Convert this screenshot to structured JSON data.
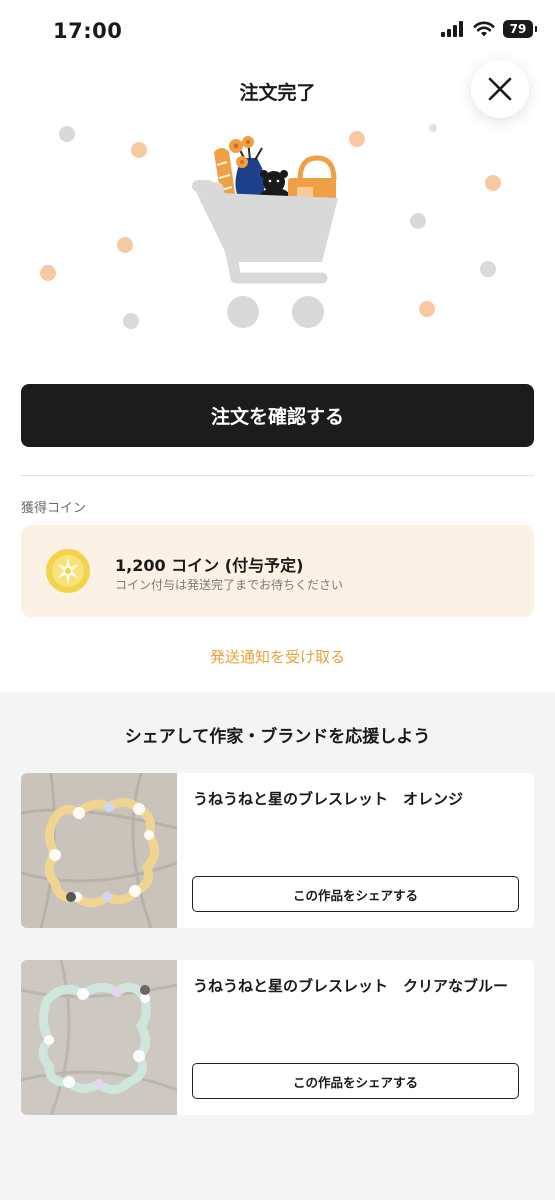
{
  "status_bar": {
    "time": "17:00",
    "battery": "79",
    "icons": [
      "signal-icon",
      "wifi-icon",
      "battery-icon"
    ]
  },
  "header": {
    "title": "注文完了",
    "close_icon": "close-icon"
  },
  "hero": {
    "illustration": "shopping-cart-illustration"
  },
  "actions": {
    "confirm_order": "注文を確認する"
  },
  "coin": {
    "section_label": "獲得コイン",
    "amount": "1,200 コイン (付与予定)",
    "note": "コイン付与は発送完了までお待ちください",
    "icon": "coin-icon"
  },
  "notify_link": "発送通知を受け取る",
  "share": {
    "title": "シェアして作家・ブランドを応援しよう",
    "products": [
      {
        "name": "うねうねと星のブレスレット　オレンジ",
        "button": "この作品をシェアする",
        "bead_color": "#f1d492"
      },
      {
        "name": "うねうねと星のブレスレット　クリアなブルー",
        "button": "この作品をシェアする",
        "bead_color": "#cfe6dc"
      }
    ]
  },
  "colors": {
    "accent": "#e8a23c",
    "primary_button": "#1c1c1c",
    "coin_card_bg": "#fcf1e5",
    "share_section_bg": "#f4f4f4"
  }
}
